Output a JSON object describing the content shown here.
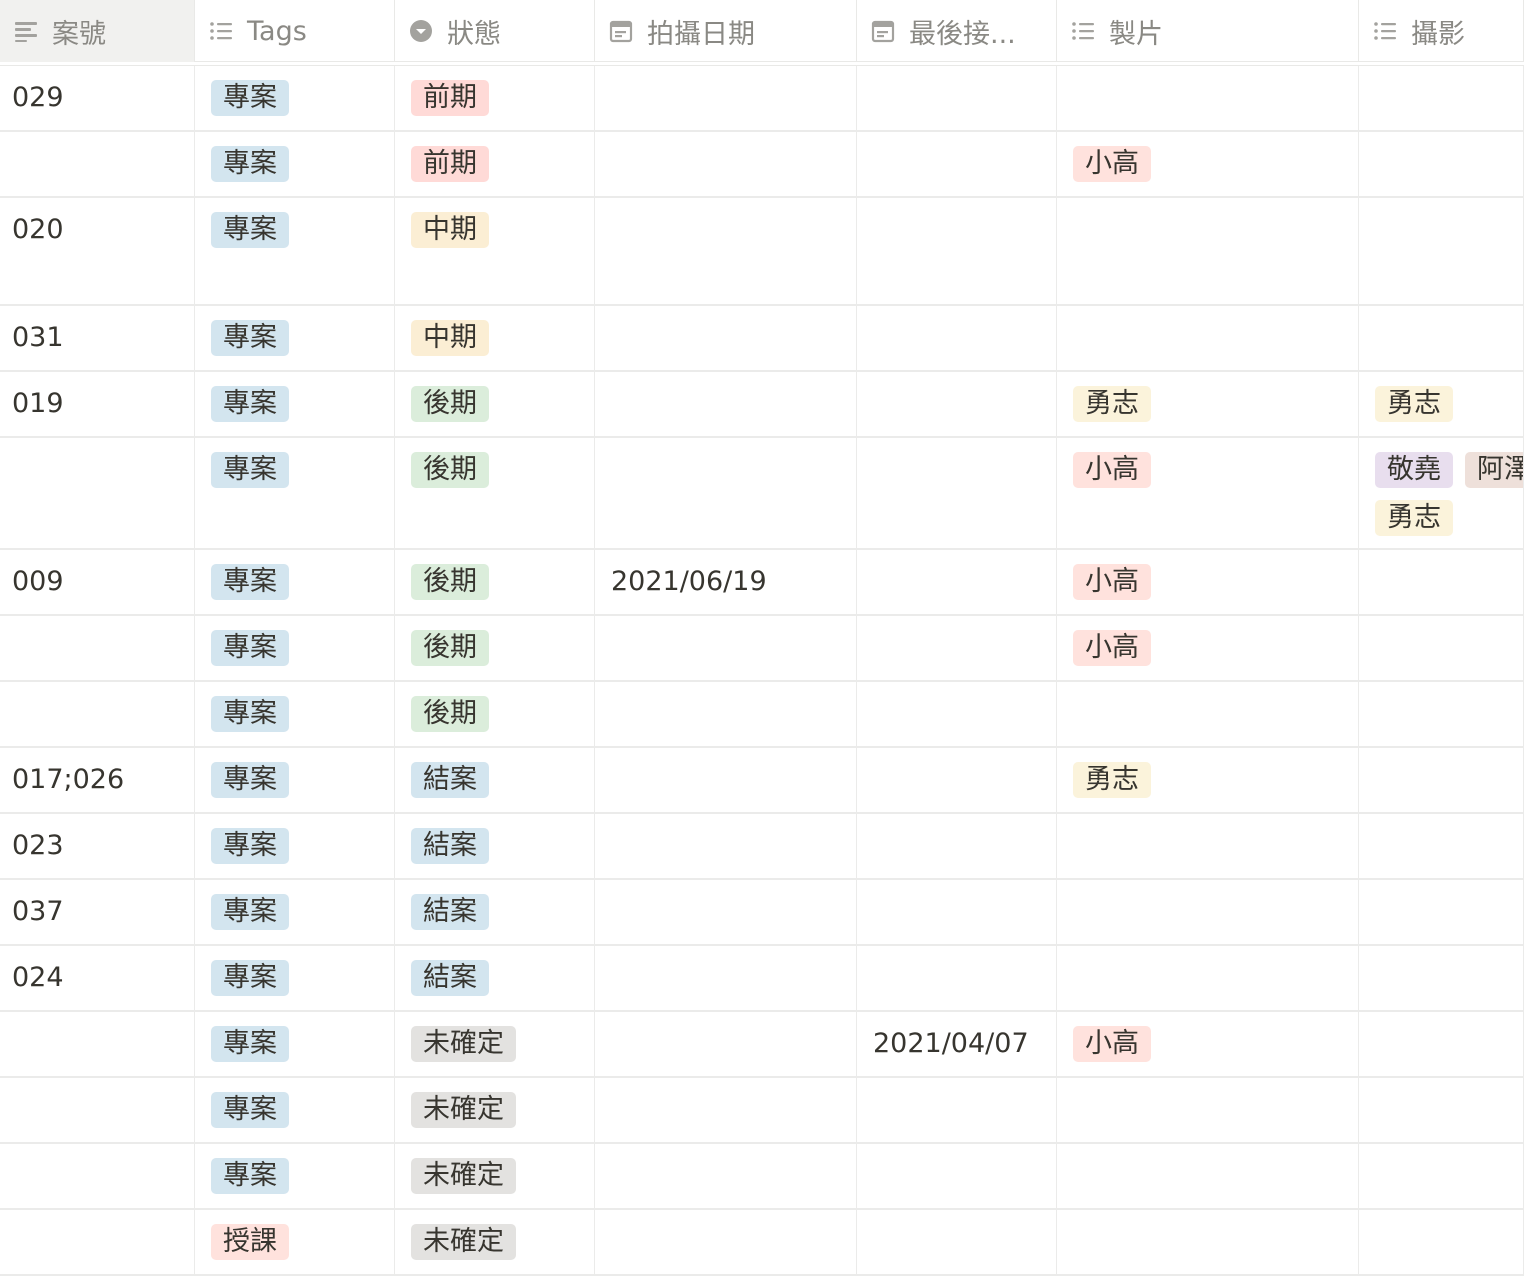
{
  "columns": [
    {
      "key": "id",
      "label": "案號",
      "icon": "text-align-icon",
      "width": 195
    },
    {
      "key": "tags",
      "label": "Tags",
      "icon": "list-icon",
      "width": 200
    },
    {
      "key": "status",
      "label": "狀態",
      "icon": "select-circle-icon",
      "width": 200
    },
    {
      "key": "shoot_date",
      "label": "拍攝日期",
      "icon": "calendar-icon",
      "width": 262
    },
    {
      "key": "last_contact",
      "label": "最後接...",
      "icon": "calendar-icon",
      "width": 200
    },
    {
      "key": "production",
      "label": "製片",
      "icon": "list-icon",
      "width": 302
    },
    {
      "key": "photography",
      "label": "攝影",
      "icon": "list-icon",
      "width": 165
    }
  ],
  "tag_colors": {
    "專案": "#d3e5ef",
    "授課": "#ffe2dd",
    "前期": "#ffdad7",
    "中期": "#fbeed4",
    "後期": "#dbeddb",
    "結案": "#d3e5ef",
    "未確定": "#e3e2e0",
    "小高": "#ffe2dd",
    "勇志": "#fbf3db",
    "敬堯": "#e8deee",
    "阿澤": "#eee0da"
  },
  "rows": [
    {
      "id": "029",
      "tags": [
        "專案"
      ],
      "status": [
        "前期"
      ],
      "shoot_date": "",
      "last_contact": "",
      "production": [],
      "photography": [],
      "height": 66
    },
    {
      "id": "",
      "tags": [
        "專案"
      ],
      "status": [
        "前期"
      ],
      "shoot_date": "",
      "last_contact": "",
      "production": [
        "小高"
      ],
      "photography": [],
      "height": 66
    },
    {
      "id": "020",
      "tags": [
        "專案"
      ],
      "status": [
        "中期"
      ],
      "shoot_date": "",
      "last_contact": "",
      "production": [],
      "photography": [],
      "height": 108
    },
    {
      "id": "031",
      "tags": [
        "專案"
      ],
      "status": [
        "中期"
      ],
      "shoot_date": "",
      "last_contact": "",
      "production": [],
      "photography": [],
      "height": 66
    },
    {
      "id": "019",
      "tags": [
        "專案"
      ],
      "status": [
        "後期"
      ],
      "shoot_date": "",
      "last_contact": "",
      "production": [
        "勇志"
      ],
      "photography": [
        "勇志"
      ],
      "height": 66
    },
    {
      "id": "",
      "tags": [
        "專案"
      ],
      "status": [
        "後期"
      ],
      "shoot_date": "",
      "last_contact": "",
      "production": [
        "小高"
      ],
      "photography": [
        "敬堯",
        "阿澤",
        "勇志"
      ],
      "height": 112
    },
    {
      "id": "009",
      "tags": [
        "專案"
      ],
      "status": [
        "後期"
      ],
      "shoot_date": "2021/06/19",
      "last_contact": "",
      "production": [
        "小高"
      ],
      "photography": [],
      "height": 66
    },
    {
      "id": "",
      "tags": [
        "專案"
      ],
      "status": [
        "後期"
      ],
      "shoot_date": "",
      "last_contact": "",
      "production": [
        "小高"
      ],
      "photography": [],
      "height": 66
    },
    {
      "id": "",
      "tags": [
        "專案"
      ],
      "status": [
        "後期"
      ],
      "shoot_date": "",
      "last_contact": "",
      "production": [],
      "photography": [],
      "height": 66
    },
    {
      "id": "017;026",
      "tags": [
        "專案"
      ],
      "status": [
        "結案"
      ],
      "shoot_date": "",
      "last_contact": "",
      "production": [
        "勇志"
      ],
      "photography": [],
      "height": 66
    },
    {
      "id": "023",
      "tags": [
        "專案"
      ],
      "status": [
        "結案"
      ],
      "shoot_date": "",
      "last_contact": "",
      "production": [],
      "photography": [],
      "height": 66
    },
    {
      "id": "037",
      "tags": [
        "專案"
      ],
      "status": [
        "結案"
      ],
      "shoot_date": "",
      "last_contact": "",
      "production": [],
      "photography": [],
      "height": 66
    },
    {
      "id": "024",
      "tags": [
        "專案"
      ],
      "status": [
        "結案"
      ],
      "shoot_date": "",
      "last_contact": "",
      "production": [],
      "photography": [],
      "height": 66
    },
    {
      "id": "",
      "tags": [
        "專案"
      ],
      "status": [
        "未確定"
      ],
      "shoot_date": "",
      "last_contact": "2021/04/07",
      "production": [
        "小高"
      ],
      "photography": [],
      "height": 66
    },
    {
      "id": "",
      "tags": [
        "專案"
      ],
      "status": [
        "未確定"
      ],
      "shoot_date": "",
      "last_contact": "",
      "production": [],
      "photography": [],
      "height": 66
    },
    {
      "id": "",
      "tags": [
        "專案"
      ],
      "status": [
        "未確定"
      ],
      "shoot_date": "",
      "last_contact": "",
      "production": [],
      "photography": [],
      "height": 66
    },
    {
      "id": "",
      "tags": [
        "授課"
      ],
      "status": [
        "未確定"
      ],
      "shoot_date": "",
      "last_contact": "",
      "production": [],
      "photography": [],
      "height": 66
    }
  ]
}
